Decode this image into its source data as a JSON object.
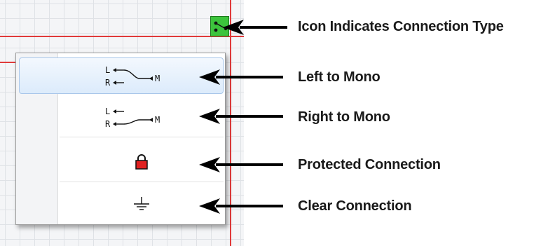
{
  "menu": {
    "items": [
      {
        "icon": "left-to-mono-icon",
        "label_l": "L",
        "label_r": "R",
        "label_m": "M"
      },
      {
        "icon": "right-to-mono-icon",
        "label_l": "L",
        "label_r": "R",
        "label_m": "M"
      },
      {
        "icon": "lock-icon"
      },
      {
        "icon": "ground-icon"
      }
    ]
  },
  "callouts": {
    "indicator": "Icon Indicates Connection Type",
    "left_to_mono": "Left to Mono",
    "right_to_mono": "Right to Mono",
    "protected": "Protected Connection",
    "clear": "Clear Connection"
  },
  "colors": {
    "grid_line_red": "#e03a3a",
    "indicator_green": "#3cc43c",
    "lock_red": "#e02020",
    "selection_blue": "#dcebfb"
  }
}
